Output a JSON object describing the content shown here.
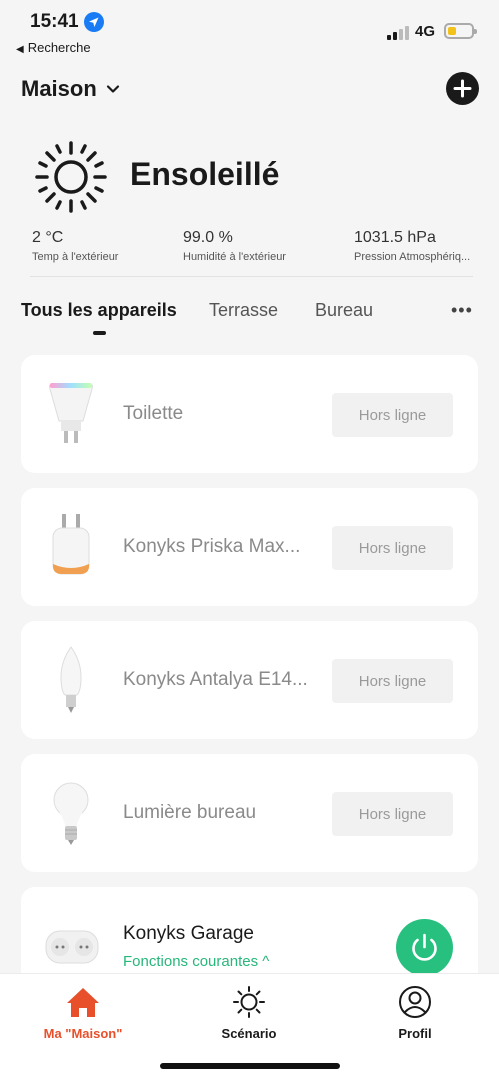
{
  "status_bar": {
    "time": "15:41",
    "back_label": "Recherche",
    "network": "4G"
  },
  "header": {
    "title": "Maison"
  },
  "weather": {
    "condition": "Ensoleillé",
    "metrics": [
      {
        "value": "2 °C",
        "label": "Temp à l'extérieur"
      },
      {
        "value": "99.0 %",
        "label": "Humidité à l'extérieur"
      },
      {
        "value": "1031.5 hPa",
        "label": "Pression Atmosphériq..."
      }
    ]
  },
  "tabs": [
    {
      "label": "Tous les appareils",
      "active": true
    },
    {
      "label": "Terrasse",
      "active": false
    },
    {
      "label": "Bureau",
      "active": false
    }
  ],
  "devices": [
    {
      "name": "Toilette",
      "status": "Hors ligne",
      "icon": "spot-bulb-icon"
    },
    {
      "name": "Konyks Priska Max...",
      "status": "Hors ligne",
      "icon": "smart-plug-icon"
    },
    {
      "name": "Konyks Antalya E14...",
      "status": "Hors ligne",
      "icon": "candle-bulb-icon"
    },
    {
      "name": "Lumière bureau",
      "status": "Hors ligne",
      "icon": "bulb-icon"
    },
    {
      "name": "Konyks Garage",
      "functions_label": "Fonctions courantes ^",
      "icon": "dual-plug-icon"
    }
  ],
  "bottom_nav": [
    {
      "label": "Ma \"Maison\"",
      "icon": "home-icon",
      "active": true
    },
    {
      "label": "Scénario",
      "icon": "sun-icon",
      "active": false
    },
    {
      "label": "Profil",
      "icon": "profile-icon",
      "active": false
    }
  ],
  "colors": {
    "accent_nav": "#e8502b",
    "power_button": "#27c07f",
    "functions_link": "#27b77a"
  }
}
